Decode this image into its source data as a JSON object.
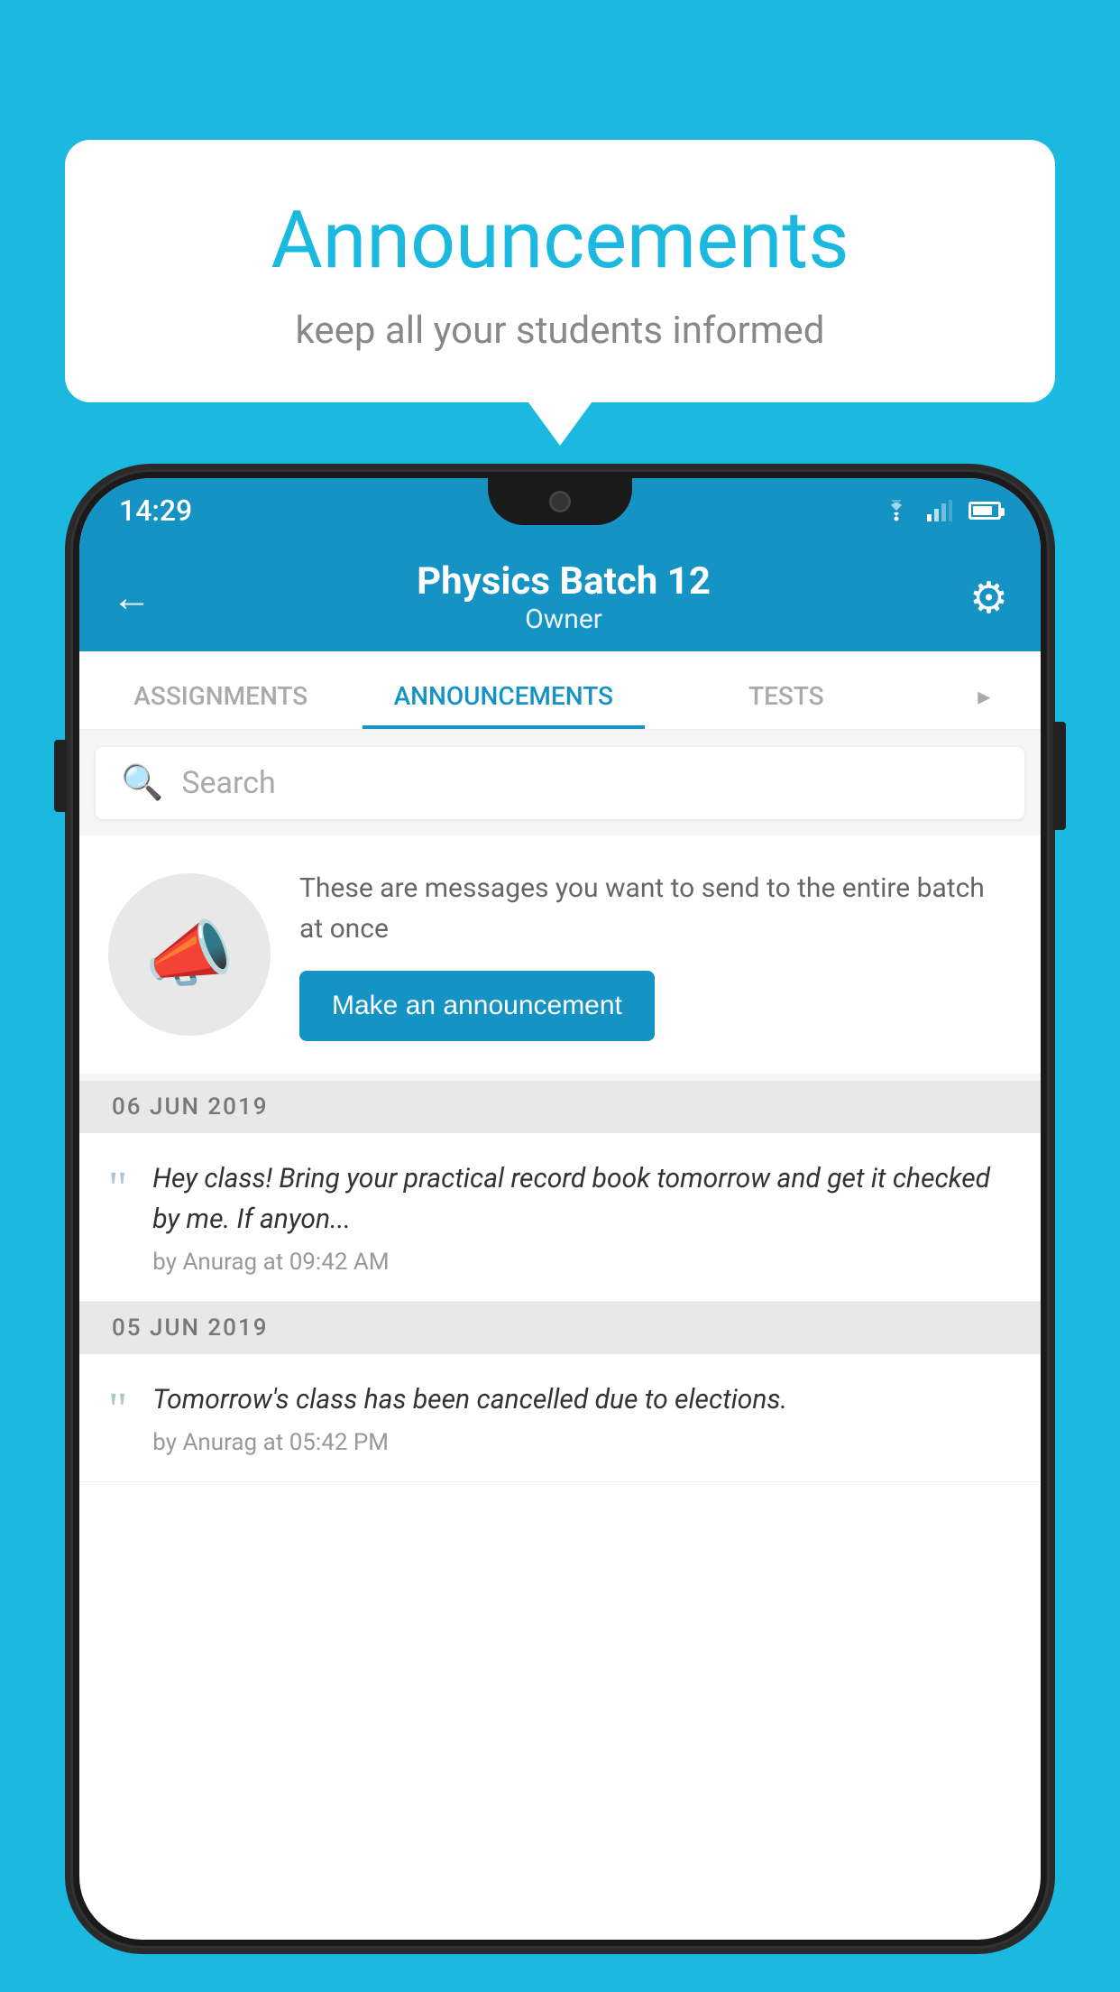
{
  "bubble": {
    "title": "Announcements",
    "subtitle": "keep all your students informed"
  },
  "statusBar": {
    "time": "14:29",
    "wifiIcon": "wifi",
    "signalIcon": "signal",
    "batteryIcon": "battery"
  },
  "appBar": {
    "title": "Physics Batch 12",
    "subtitle": "Owner",
    "backLabel": "←",
    "gearLabel": "⚙"
  },
  "tabs": [
    {
      "label": "ASSIGNMENTS",
      "active": false
    },
    {
      "label": "ANNOUNCEMENTS",
      "active": true
    },
    {
      "label": "TESTS",
      "active": false
    },
    {
      "label": "...",
      "active": false
    }
  ],
  "search": {
    "placeholder": "Search"
  },
  "announcementPrompt": {
    "description": "These are messages you want to send to the entire batch at once",
    "buttonLabel": "Make an announcement"
  },
  "announcements": [
    {
      "date": "06  JUN  2019",
      "items": [
        {
          "text": "Hey class! Bring your practical record book tomorrow and get it checked by me. If anyon...",
          "meta": "by Anurag at 09:42 AM"
        }
      ]
    },
    {
      "date": "05  JUN  2019",
      "items": [
        {
          "text": "Tomorrow's class has been cancelled due to elections.",
          "meta": "by Anurag at 05:42 PM"
        }
      ]
    }
  ]
}
